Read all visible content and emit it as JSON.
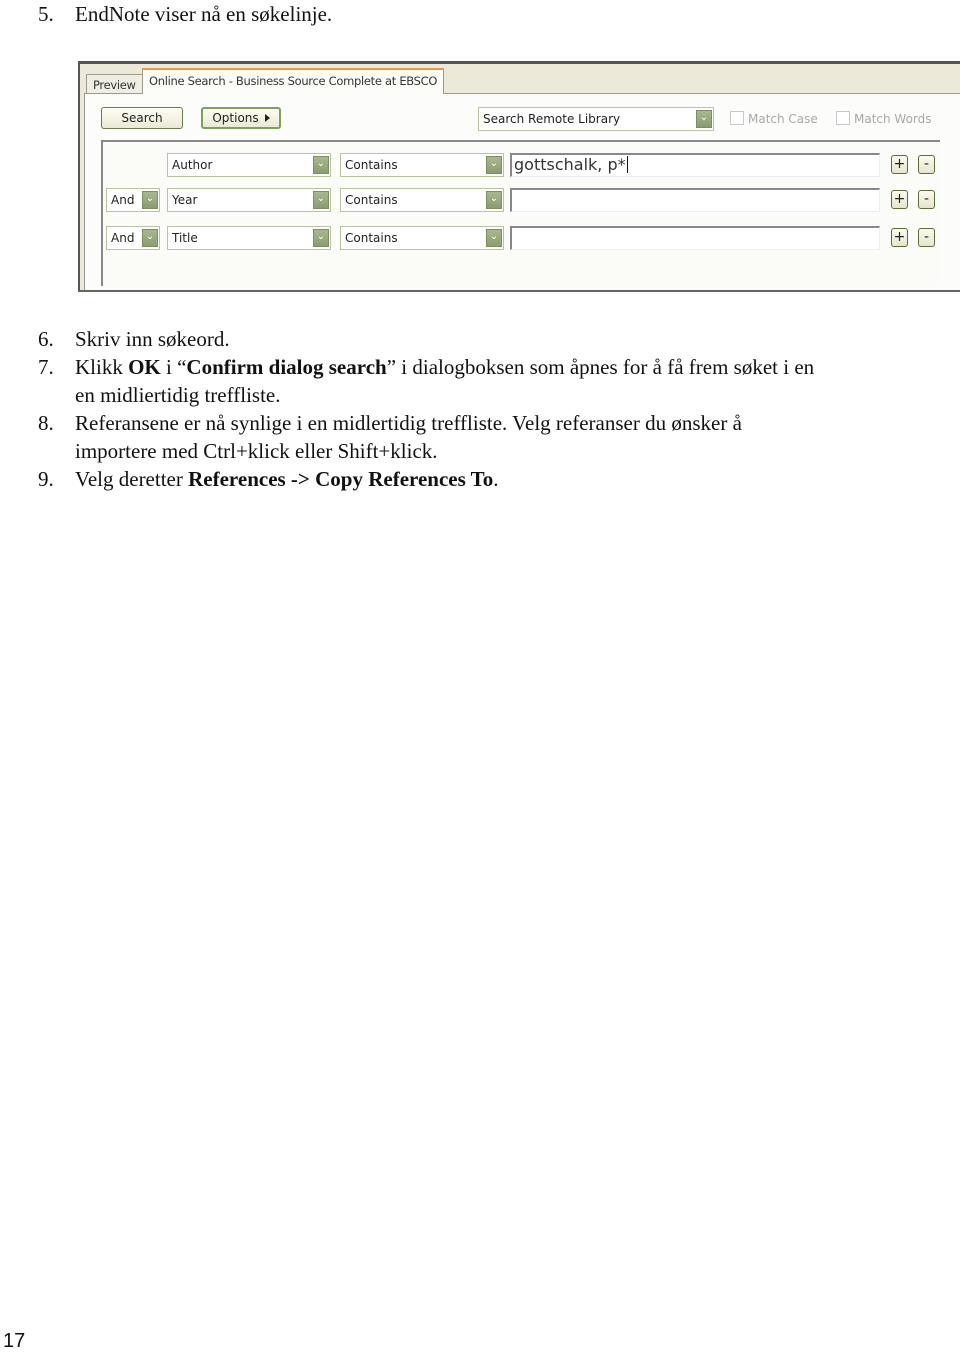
{
  "document": {
    "steps": [
      {
        "num": "5.",
        "text": "EndNote viser nå en søkelinje."
      },
      {
        "num": "6.",
        "text": "Skriv inn søkeord."
      },
      {
        "num": "7.",
        "parts": [
          "Klikk ",
          "OK",
          " i “",
          "Confirm dialog search",
          "” i dialogboksen som åpnes for å få frem søket i en"
        ],
        "continuation": "en midliertidig treffliste."
      },
      {
        "num": "8.",
        "text": "Referansene er nå synlige i en midlertidig treffliste. Velg referanser du ønsker å",
        "continuation": "importere med Ctrl+klick eller Shift+klick."
      },
      {
        "num": "9.",
        "parts": [
          "Velg deretter ",
          "References ->  Copy References To",
          "."
        ]
      }
    ],
    "page_number": "17"
  },
  "screenshot": {
    "tabs": [
      {
        "label": "Preview",
        "active": false
      },
      {
        "label": "Online Search - Business Source Complete at EBSCO",
        "active": true
      }
    ],
    "toolbar": {
      "search_label": "Search",
      "options_label": "Options",
      "library_select": "Search Remote Library",
      "match_case_label": "Match Case",
      "match_words_label": "Match Words"
    },
    "search_rows": [
      {
        "bool": "",
        "field": "Author",
        "operator": "Contains",
        "value": "gottschalk, p*"
      },
      {
        "bool": "And",
        "field": "Year",
        "operator": "Contains",
        "value": ""
      },
      {
        "bool": "And",
        "field": "Title",
        "operator": "Contains",
        "value": ""
      }
    ],
    "add_label": "+",
    "remove_label": "-",
    "icons": {
      "dropdown": "chevron-down-icon",
      "options_arrow": "triangle-right-icon"
    },
    "colors": {
      "tab_accent": "#e89a3c",
      "dropdown_green": "#8a9c70",
      "panel_bg": "#ece9d8"
    }
  }
}
